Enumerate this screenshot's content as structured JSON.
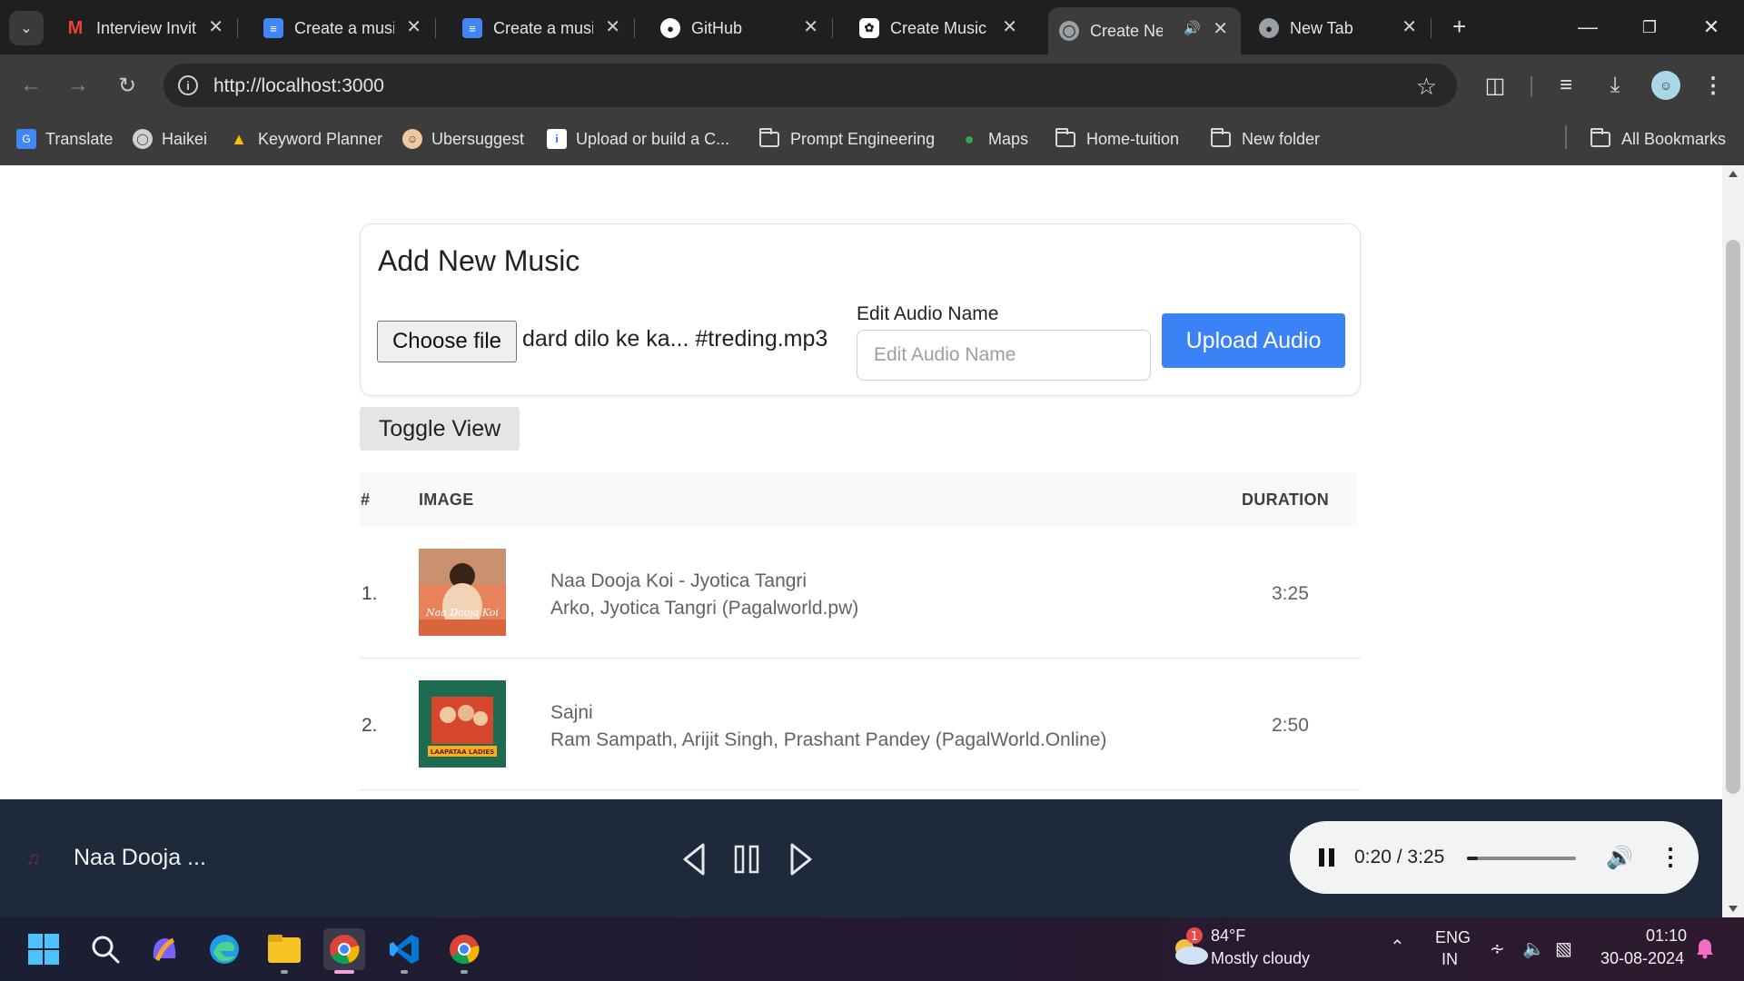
{
  "browser": {
    "tabs": [
      {
        "title": "Interview Invit",
        "favicon": "gmail-icon"
      },
      {
        "title": "Create a music",
        "favicon": "google-docs-icon"
      },
      {
        "title": "Create a music",
        "favicon": "google-docs-icon"
      },
      {
        "title": "GitHub",
        "favicon": "github-icon"
      },
      {
        "title": "Create Music I",
        "favicon": "chatgpt-icon"
      },
      {
        "title": "Create Ne",
        "favicon": "globe-icon",
        "active": true,
        "audio": true
      },
      {
        "title": "New Tab",
        "favicon": "chrome-icon"
      }
    ],
    "url": "http://localhost:3000"
  },
  "bookmarks": [
    {
      "label": "Translate",
      "icon": "google-translate-icon"
    },
    {
      "label": "Haikei",
      "icon": "globe-icon"
    },
    {
      "label": "Keyword Planner",
      "icon": "google-ads-icon"
    },
    {
      "label": "Ubersuggest",
      "icon": "ubersuggest-icon"
    },
    {
      "label": "Upload or build a C...",
      "icon": "upload-icon"
    },
    {
      "label": "Prompt Engineering",
      "icon": "folder-icon"
    },
    {
      "label": "Maps",
      "icon": "maps-icon"
    },
    {
      "label": "Home-tuition",
      "icon": "folder-icon"
    },
    {
      "label": "New folder",
      "icon": "folder-icon"
    },
    {
      "label": "All Bookmarks",
      "icon": "folder-icon"
    }
  ],
  "upload_card": {
    "title": "Add New Music",
    "choose_file_label": "Choose file",
    "file_name": "dard dilo ke ka... #treding.mp3",
    "edit_label": "Edit Audio Name",
    "edit_placeholder": "Edit Audio Name",
    "upload_label": "Upload Audio"
  },
  "toggle_view_label": "Toggle View",
  "table": {
    "headers": {
      "num": "#",
      "image": "IMAGE",
      "duration": "DURATION"
    },
    "rows": [
      {
        "num": "1.",
        "title": "Naa Dooja Koi - Jyotica Tangri",
        "artist": "Arko, Jyotica Tangri (Pagalworld.pw)",
        "duration": "3:25",
        "thumb_text": "Naa Dooja Koi"
      },
      {
        "num": "2.",
        "title": "Sajni",
        "artist": "Ram Sampath, Arijit Singh, Prashant Pandey (PagalWorld.Online)",
        "duration": "2:50",
        "thumb_text": "LAAPATAA LADIES"
      }
    ]
  },
  "player": {
    "now_playing": "Naa Dooja ...",
    "time": "0:20 / 3:25",
    "progress": 0.1
  },
  "taskbar": {
    "weather_badge": "1",
    "temperature": "84°F",
    "weather": "Mostly cloudy",
    "lang": "ENG",
    "region": "IN",
    "time": "01:10",
    "date": "30-08-2024"
  }
}
